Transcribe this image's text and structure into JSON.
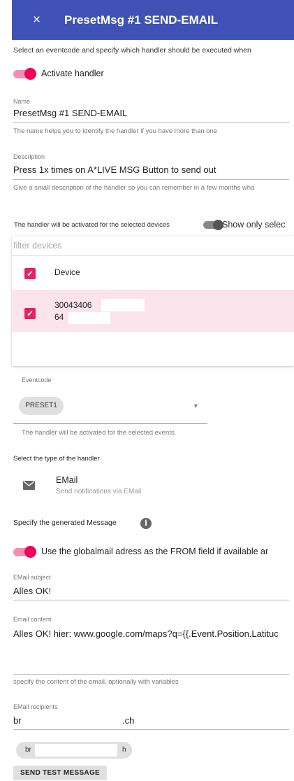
{
  "header": {
    "close_icon": "×",
    "title": "PresetMsg #1 SEND-EMAIL",
    "color": "#3f51b5"
  },
  "intro": "Select an eventcode and specify which handler should be executed when",
  "activate": {
    "label": "Activate handler",
    "on": true
  },
  "name_field": {
    "label": "Name",
    "value": "PresetMsg #1 SEND-EMAIL",
    "hint": "The name helps you to identify the handler if you have more than one"
  },
  "description_field": {
    "label": "Description",
    "value": "Press 1x times on A*LIVE MSG Button to send out",
    "hint": "Give a small description of the handler so you can remember in a few months wha"
  },
  "devices": {
    "heading": "The handler will be activated for the selected devices",
    "show_only_label": "Show only selec",
    "show_only_on": false,
    "filter_placeholder": "filter devices",
    "column_header": "Device",
    "rows": [
      {
        "line1": "30043406",
        "line2": "64",
        "checked": true
      }
    ]
  },
  "eventcode": {
    "label": "Eventcode",
    "chip": "PRESET1",
    "hint": "The handler will be activated for the selected events."
  },
  "handler_type": {
    "label": "Select the type of the handler",
    "title": "EMail",
    "subtitle": "Send notifications via EMail",
    "icon": "mail-icon"
  },
  "message": {
    "label": "Specify the generated Message",
    "icon": "info-icon"
  },
  "globalmail": {
    "label": "Use the globalmail adress as the FROM field if available ar",
    "on": true
  },
  "subject": {
    "label": "EMail subject",
    "value": "Alles OK!"
  },
  "content": {
    "label": "Email content",
    "value": "Alles OK! hier: www.google.com/maps?q={{.Event.Position.Latituc",
    "hint": "specify the content of the email, optionally with variables"
  },
  "recipients": {
    "label": "EMail recipients",
    "value_start": "br",
    "value_end": ".ch",
    "chip_start": "br",
    "chip_end": "h"
  },
  "test_button": "SEND TEST MESSAGE",
  "accent": "#e91e63"
}
